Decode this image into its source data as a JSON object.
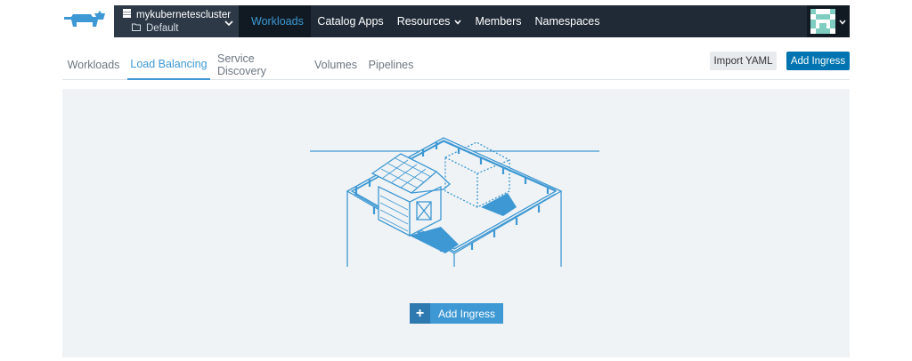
{
  "header": {
    "cluster_name": "mykubernetescluster",
    "project_name": "Default",
    "nav": [
      {
        "label": "Workloads"
      },
      {
        "label": "Catalog Apps"
      },
      {
        "label": "Resources"
      },
      {
        "label": "Members"
      },
      {
        "label": "Namespaces"
      }
    ]
  },
  "subnav": {
    "tabs": [
      {
        "label": "Workloads"
      },
      {
        "label": "Load Balancing"
      },
      {
        "label": "Service Discovery"
      },
      {
        "label": "Volumes"
      },
      {
        "label": "Pipelines"
      }
    ],
    "import_label": "Import YAML",
    "add_label": "Add Ingress"
  },
  "empty_state": {
    "plus": "+",
    "add_label": "Add Ingress"
  },
  "colors": {
    "accent": "#3d98d3",
    "primary_button": "#0074b0",
    "topbar": "#1f2a36",
    "panel": "#f0f3f5"
  },
  "icons": [
    "rancher-logo",
    "cluster-icon",
    "folder-icon",
    "chevron-down-icon",
    "avatar",
    "plus-icon",
    "farm-illustration"
  ]
}
